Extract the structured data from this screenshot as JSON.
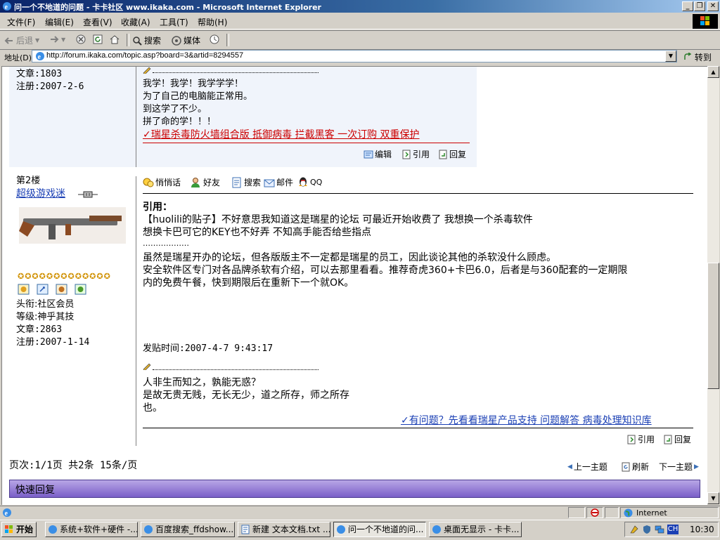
{
  "window": {
    "title": "问一个不地道的问题 - 卡卡社区 www.ikaka.com - Microsoft Internet Explorer",
    "minimize": "_",
    "maximize": "❐",
    "close": "✕"
  },
  "menu": [
    "文件(F)",
    "编辑(E)",
    "查看(V)",
    "收藏(A)",
    "工具(T)",
    "帮助(H)"
  ],
  "toolbar": {
    "back": "后退",
    "forward": "",
    "search": "搜索",
    "media": "媒体"
  },
  "address": {
    "label": "地址(D)",
    "url": "http://forum.ikaka.com/topic.asp?board=3&artid=8294557",
    "go": "转到"
  },
  "post1": {
    "articles": "文章:1803",
    "registered": "注册:2007-2-6",
    "signature": [
      "我学！我学！我学学学！",
      "为了自己的电脑能正常用。",
      "到这学了不少。",
      "拼了命的学！！！"
    ],
    "ad_link": "✓瑞星杀毒防火墙组合版 抵御病毒 拦截黑客 一次订购 双重保护",
    "actions": [
      "编辑",
      "引用",
      "回复"
    ]
  },
  "post2": {
    "floor": "第2楼",
    "username": "超级游戏迷",
    "rank_title": "头衔:社区会员",
    "level": "等级:神乎其技",
    "articles": "文章:2863",
    "registered": "注册:2007-1-14",
    "user_actions": [
      "悄悄话",
      "好友",
      "搜索",
      "邮件",
      "QQ"
    ],
    "quote_label": "引用：",
    "quote_lines": [
      "【huolili的贴子】不好意思我知道这是瑞星的论坛 可最近开始收费了 我想换一个杀毒软件",
      "想换卡巴可它的KEY也不好弄 不知高手能否给些指点",
      "………………"
    ],
    "body_lines": [
      "虽然是瑞星开办的论坛，但各版版主不一定都是瑞星的员工，因此谈论其他的杀软没什么顾虑。",
      "安全软件区专门对各品牌杀软有介绍，可以去那里看看。推荐奇虎360+卡巴6.0，后者是与360配套的一定期限",
      "内的免费午餐，快到期限后在重新下一个就OK。"
    ],
    "post_time": "发贴时间:2007-4-7 9:43:17",
    "signature": [
      "人非生而知之，孰能无惑？",
      "是故无贵无贱，无长无少，道之所存，师之所存",
      "也。"
    ],
    "support_link": "✓有问题？先看看瑞星产品支持 问题解答 病毒处理知识库",
    "actions": [
      "引用",
      "回复"
    ]
  },
  "footer": {
    "pagination": "页次:1/1页 共2条 15条/页",
    "prev_topic": "上一主题",
    "refresh": "刷新",
    "next_topic": "下一主题",
    "quick_reply": "快速回复"
  },
  "statusbar": {
    "zone": "Internet"
  },
  "taskbar": {
    "start": "开始",
    "tasks": [
      "系统+软件+硬件 -...",
      "百度搜索_ffdshow....",
      "新建 文本文档.txt ...",
      "问一个不地道的问...",
      "桌面无显示 - 卡卡..."
    ],
    "lang": "CH",
    "clock": "10:30"
  }
}
